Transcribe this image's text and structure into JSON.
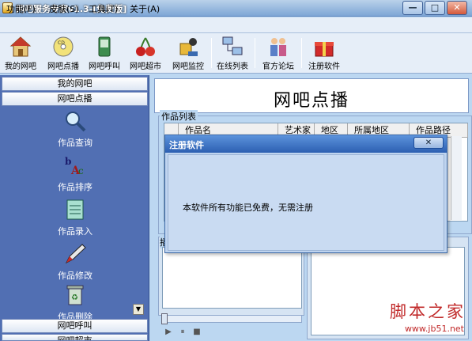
{
  "window": {
    "title": "网吧服务专家v1.3-[免费版]",
    "min": "—",
    "max": "□",
    "close": "✕"
  },
  "menu": [
    "功能(F)",
    "皮肤(S)",
    "工具(T)",
    "关于(A)"
  ],
  "toolbar": [
    {
      "label": "我的网吧",
      "icon": "house-icon"
    },
    {
      "label": "网吧点播",
      "icon": "cd-icon"
    },
    {
      "label": "网吧呼叫",
      "icon": "phone-icon"
    },
    {
      "label": "网吧超市",
      "icon": "cherry-icon"
    },
    {
      "label": "网吧监控",
      "icon": "monitor-camera-icon"
    },
    {
      "label": "在线列表",
      "icon": "network-icon"
    },
    {
      "label": "官方论坛",
      "icon": "people-icon"
    },
    {
      "label": "注册软件",
      "icon": "gift-icon"
    }
  ],
  "sidebar": {
    "headers": [
      "我的网吧",
      "网吧点播",
      "网吧呼叫",
      "网吧超市"
    ],
    "items": [
      {
        "label": "作品查询",
        "icon": "magnifier-icon"
      },
      {
        "label": "作品排序",
        "icon": "abc-sort-icon"
      },
      {
        "label": "作品录入",
        "icon": "notepad-icon"
      },
      {
        "label": "作品修改",
        "icon": "pen-icon"
      },
      {
        "label": "作品删除",
        "icon": "recycle-bin-icon"
      }
    ],
    "scroll_down": "▼"
  },
  "main": {
    "banner_title": "网吧点播",
    "works_group_label": "作品列表",
    "table_columns": [
      "作品名",
      "艺术家",
      "地区",
      "所属地区",
      "作品路径"
    ],
    "lower_group_label": "播",
    "controls": {
      "play": "▶",
      "pause": "⏸",
      "stop": "■"
    }
  },
  "dialog": {
    "title": "注册软件",
    "close": "✕",
    "message": "本软件所有功能已免费，无需注册"
  },
  "watermark": {
    "title": "脚本之家",
    "url": "www.jb51.net"
  }
}
